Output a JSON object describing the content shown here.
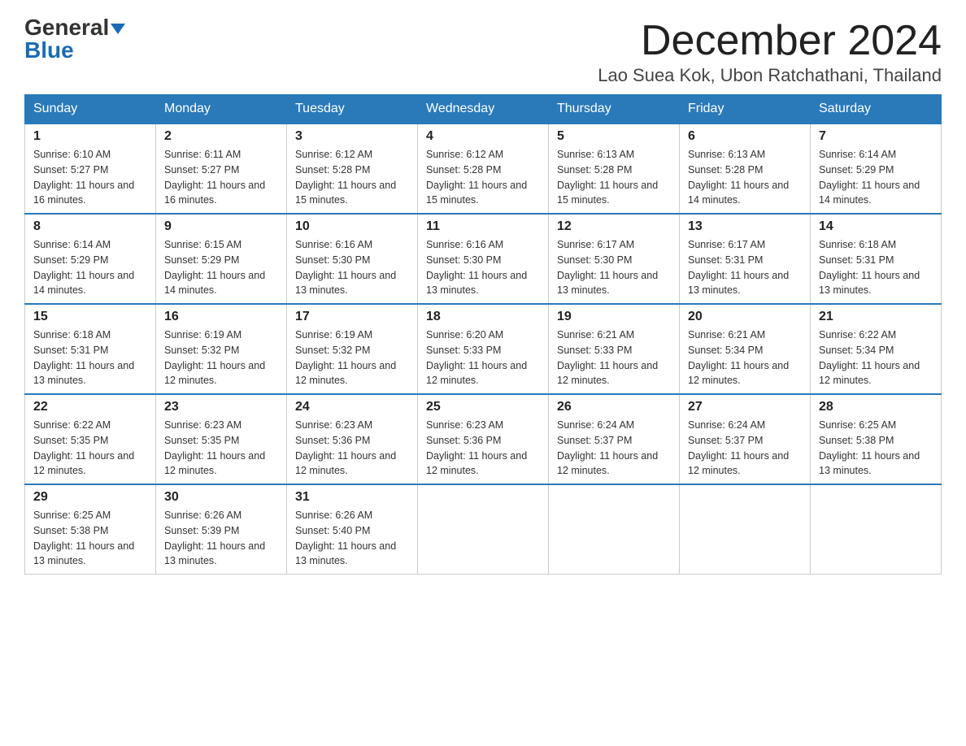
{
  "logo": {
    "line1": "General",
    "line2": "Blue"
  },
  "title": "December 2024",
  "location": "Lao Suea Kok, Ubon Ratchathani, Thailand",
  "days_of_week": [
    "Sunday",
    "Monday",
    "Tuesday",
    "Wednesday",
    "Thursday",
    "Friday",
    "Saturday"
  ],
  "weeks": [
    [
      {
        "day": "1",
        "sunrise": "6:10 AM",
        "sunset": "5:27 PM",
        "daylight": "11 hours and 16 minutes."
      },
      {
        "day": "2",
        "sunrise": "6:11 AM",
        "sunset": "5:27 PM",
        "daylight": "11 hours and 16 minutes."
      },
      {
        "day": "3",
        "sunrise": "6:12 AM",
        "sunset": "5:28 PM",
        "daylight": "11 hours and 15 minutes."
      },
      {
        "day": "4",
        "sunrise": "6:12 AM",
        "sunset": "5:28 PM",
        "daylight": "11 hours and 15 minutes."
      },
      {
        "day": "5",
        "sunrise": "6:13 AM",
        "sunset": "5:28 PM",
        "daylight": "11 hours and 15 minutes."
      },
      {
        "day": "6",
        "sunrise": "6:13 AM",
        "sunset": "5:28 PM",
        "daylight": "11 hours and 14 minutes."
      },
      {
        "day": "7",
        "sunrise": "6:14 AM",
        "sunset": "5:29 PM",
        "daylight": "11 hours and 14 minutes."
      }
    ],
    [
      {
        "day": "8",
        "sunrise": "6:14 AM",
        "sunset": "5:29 PM",
        "daylight": "11 hours and 14 minutes."
      },
      {
        "day": "9",
        "sunrise": "6:15 AM",
        "sunset": "5:29 PM",
        "daylight": "11 hours and 14 minutes."
      },
      {
        "day": "10",
        "sunrise": "6:16 AM",
        "sunset": "5:30 PM",
        "daylight": "11 hours and 13 minutes."
      },
      {
        "day": "11",
        "sunrise": "6:16 AM",
        "sunset": "5:30 PM",
        "daylight": "11 hours and 13 minutes."
      },
      {
        "day": "12",
        "sunrise": "6:17 AM",
        "sunset": "5:30 PM",
        "daylight": "11 hours and 13 minutes."
      },
      {
        "day": "13",
        "sunrise": "6:17 AM",
        "sunset": "5:31 PM",
        "daylight": "11 hours and 13 minutes."
      },
      {
        "day": "14",
        "sunrise": "6:18 AM",
        "sunset": "5:31 PM",
        "daylight": "11 hours and 13 minutes."
      }
    ],
    [
      {
        "day": "15",
        "sunrise": "6:18 AM",
        "sunset": "5:31 PM",
        "daylight": "11 hours and 13 minutes."
      },
      {
        "day": "16",
        "sunrise": "6:19 AM",
        "sunset": "5:32 PM",
        "daylight": "11 hours and 12 minutes."
      },
      {
        "day": "17",
        "sunrise": "6:19 AM",
        "sunset": "5:32 PM",
        "daylight": "11 hours and 12 minutes."
      },
      {
        "day": "18",
        "sunrise": "6:20 AM",
        "sunset": "5:33 PM",
        "daylight": "11 hours and 12 minutes."
      },
      {
        "day": "19",
        "sunrise": "6:21 AM",
        "sunset": "5:33 PM",
        "daylight": "11 hours and 12 minutes."
      },
      {
        "day": "20",
        "sunrise": "6:21 AM",
        "sunset": "5:34 PM",
        "daylight": "11 hours and 12 minutes."
      },
      {
        "day": "21",
        "sunrise": "6:22 AM",
        "sunset": "5:34 PM",
        "daylight": "11 hours and 12 minutes."
      }
    ],
    [
      {
        "day": "22",
        "sunrise": "6:22 AM",
        "sunset": "5:35 PM",
        "daylight": "11 hours and 12 minutes."
      },
      {
        "day": "23",
        "sunrise": "6:23 AM",
        "sunset": "5:35 PM",
        "daylight": "11 hours and 12 minutes."
      },
      {
        "day": "24",
        "sunrise": "6:23 AM",
        "sunset": "5:36 PM",
        "daylight": "11 hours and 12 minutes."
      },
      {
        "day": "25",
        "sunrise": "6:23 AM",
        "sunset": "5:36 PM",
        "daylight": "11 hours and 12 minutes."
      },
      {
        "day": "26",
        "sunrise": "6:24 AM",
        "sunset": "5:37 PM",
        "daylight": "11 hours and 12 minutes."
      },
      {
        "day": "27",
        "sunrise": "6:24 AM",
        "sunset": "5:37 PM",
        "daylight": "11 hours and 12 minutes."
      },
      {
        "day": "28",
        "sunrise": "6:25 AM",
        "sunset": "5:38 PM",
        "daylight": "11 hours and 13 minutes."
      }
    ],
    [
      {
        "day": "29",
        "sunrise": "6:25 AM",
        "sunset": "5:38 PM",
        "daylight": "11 hours and 13 minutes."
      },
      {
        "day": "30",
        "sunrise": "6:26 AM",
        "sunset": "5:39 PM",
        "daylight": "11 hours and 13 minutes."
      },
      {
        "day": "31",
        "sunrise": "6:26 AM",
        "sunset": "5:40 PM",
        "daylight": "11 hours and 13 minutes."
      },
      null,
      null,
      null,
      null
    ]
  ]
}
